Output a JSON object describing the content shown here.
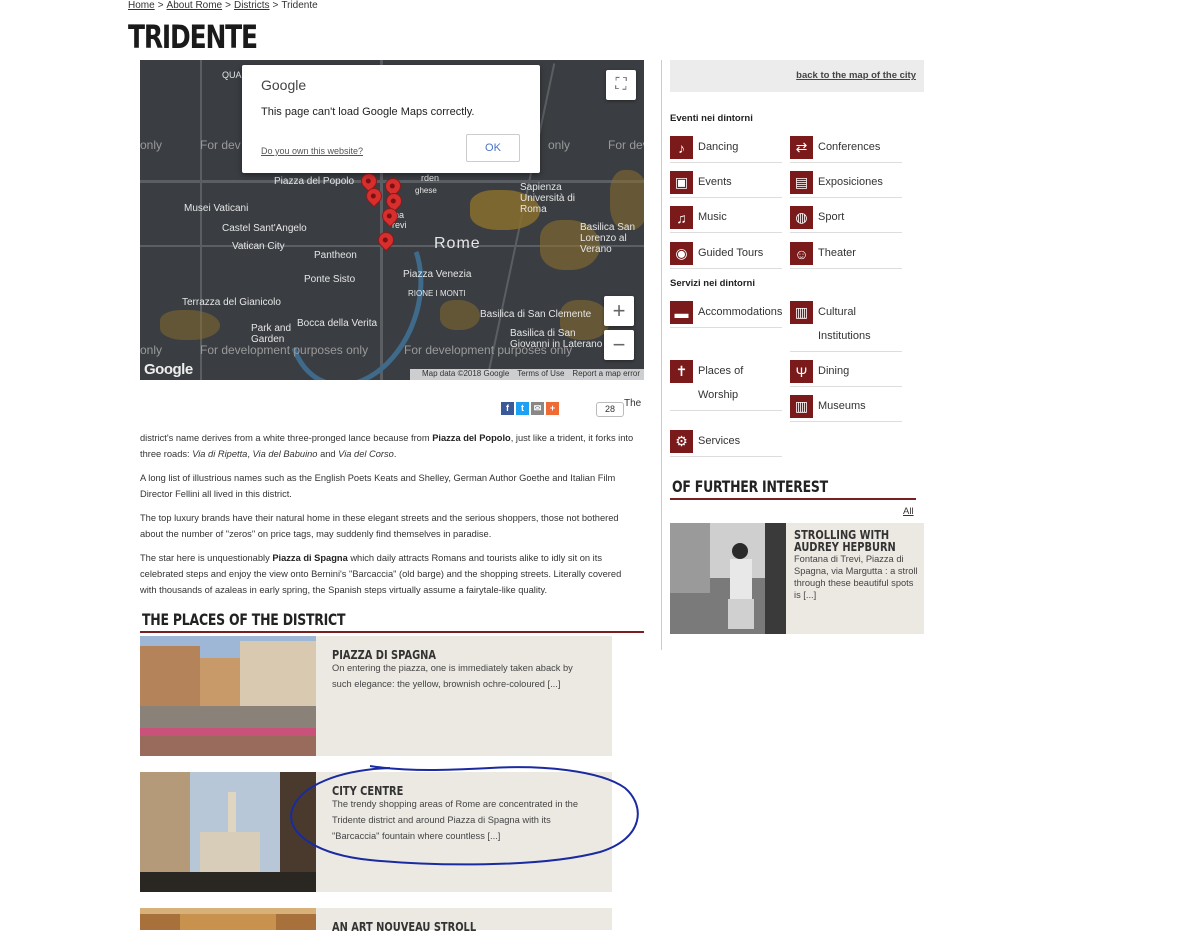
{
  "breadcrumb": {
    "home": "Home",
    "about": "About Rome",
    "districts": "Districts",
    "current": "Tridente",
    "sep": ">"
  },
  "page_title": "TRIDENTE",
  "map": {
    "dialog_brand": "Google",
    "dialog_message": "This page can't load Google Maps correctly.",
    "dialog_own_link": "Do you own this website?",
    "dialog_ok": "OK",
    "dev_text": "For development purposes only",
    "dev_fragment_left": "only",
    "dev_fragment_fordev": "For dev",
    "labels": {
      "quar": "QUAR",
      "piazza_popolo": "Piazza del Popolo",
      "musei_vaticani": "Musei Vaticani",
      "castel": "Castel Sant'Angelo",
      "vatican": "Vatican City",
      "pantheon": "Pantheon",
      "rome": "Rome",
      "ponte_sisto": "Ponte Sisto",
      "piazza_venezia": "Piazza Venezia",
      "rione": "RIONE I MONTI",
      "terrazza": "Terrazza del Gianicolo",
      "park": "Park and Garden",
      "bocca": "Bocca della Verita",
      "basilica_clemente": "Basilica di San Clemente",
      "basilica_giovanni": "Basilica di San Giovanni in Laterano",
      "sapienza": "Sapienza Università di Roma",
      "basilica_lorenzo": "Basilica San Lorenzo al Verano",
      "ghese": "ghese",
      "garden": "rden",
      "ma": "na",
      "revi": "revi"
    },
    "footer": {
      "data": "Map data ©2018 Google",
      "terms": "Terms of Use",
      "report": "Report a map error"
    },
    "logo": "Google",
    "zoom_in": "+",
    "zoom_out": "−"
  },
  "share": {
    "count": "28",
    "trailing": "The"
  },
  "article": {
    "p1_pre": "district's name derives from a white three-pronged lance because from ",
    "p1_bold": "Piazza del Popolo",
    "p1_mid": ", just like a trident, it forks into three roads: ",
    "p1_it1": "Via di Ripetta",
    "p1_c": ", ",
    "p1_it2": "Via del Babuino",
    "p1_and": " and ",
    "p1_it3": "Via del Corso",
    "p1_end": ".",
    "p2": "A long list of illustrious names such as the English Poets Keats and Shelley, German Author Goethe and Italian Film Director Fellini all lived in this district.",
    "p3": "The top luxury brands have their natural home in these elegant streets and the serious shoppers, those not bothered about the number of \"zeros\" on price tags, may suddenly find themselves in paradise.",
    "p4_pre": "The star here is unquestionably ",
    "p4_bold": "Piazza di Spagna",
    "p4_post": " which daily attracts Romans and tourists alike to idly sit on its celebrated steps and enjoy the view onto Bernini's \"Barcaccia\" (old barge) and the shopping streets. Literally covered with thousands of azaleas in early spring, the Spanish steps virtually assume a fairytale-like quality."
  },
  "places": {
    "heading": "THE PLACES OF THE DISTRICT",
    "items": [
      {
        "title": "PIAZZA DI SPAGNA",
        "desc": "On entering the piazza, one is immediately taken aback by such elegance: the yellow, brownish ochre-coloured [...]"
      },
      {
        "title": "CITY CENTRE",
        "desc": "The trendy shopping areas of Rome are concentrated in the Tridente district and around Piazza di Spagna with its \"Barcaccia\" fountain where countless [...]"
      },
      {
        "title": "AN ART NOUVEAU STROLL",
        "desc": ""
      }
    ]
  },
  "sidebar": {
    "back_link": "back to the map of the city",
    "events_heading": "Eventi nei dintorni",
    "events": [
      {
        "label": "Dancing",
        "icon": "dancing-icon",
        "glyph": "♪"
      },
      {
        "label": "Conferences",
        "icon": "conferences-icon",
        "glyph": "⇄"
      },
      {
        "label": "Events",
        "icon": "events-icon",
        "glyph": "▣"
      },
      {
        "label": "Exposiciones",
        "icon": "exhibitions-icon",
        "glyph": "▤"
      },
      {
        "label": "Music",
        "icon": "music-icon",
        "glyph": "♫"
      },
      {
        "label": "Sport",
        "icon": "sport-icon",
        "glyph": "◍"
      },
      {
        "label": "Guided Tours",
        "icon": "eye-icon",
        "glyph": "◉"
      },
      {
        "label": "Theater",
        "icon": "theater-masks-icon",
        "glyph": "☺"
      }
    ],
    "services_heading": "Servizi nei dintorni",
    "services": [
      {
        "label": "Accommodations",
        "icon": "bed-icon",
        "glyph": "▬"
      },
      {
        "label": "Cultural Institutions",
        "icon": "institution-icon",
        "glyph": "▥"
      },
      {
        "label": "Places of Worship",
        "icon": "cross-icon",
        "glyph": "✝"
      },
      {
        "label": "Dining",
        "icon": "cutlery-icon",
        "glyph": "Ψ"
      },
      {
        "label": "Museums",
        "icon": "museum-icon",
        "glyph": "▥"
      },
      {
        "label": "Services",
        "icon": "gears-icon",
        "glyph": "⚙"
      }
    ],
    "further_heading": "OF FURTHER INTEREST",
    "all_link": "All",
    "further_item": {
      "title": "STROLLING WITH AUDREY HEPBURN",
      "desc": "Fontana di Trevi, Piazza di Spagna, via Margutta : a stroll through these beautiful spots is [...]"
    }
  },
  "colors": {
    "accent": "#7a1a1a",
    "card_bg": "#ece9e3",
    "annotation": "#1a2aa0"
  }
}
